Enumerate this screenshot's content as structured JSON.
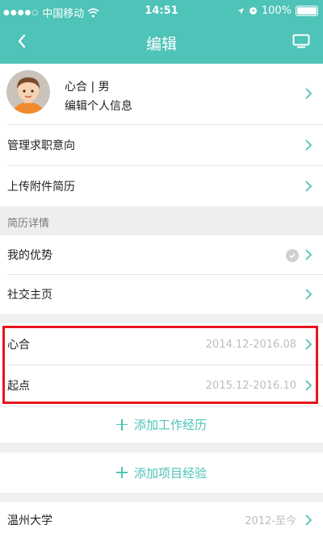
{
  "status_bar": {
    "dots": "●●●●○",
    "carrier": "中国移动",
    "time": "14:51",
    "battery": "100%"
  },
  "nav": {
    "title": "编辑"
  },
  "profile": {
    "name": "心合 | 男",
    "edit_label": "编辑个人信息"
  },
  "menu": {
    "job_intent": "管理求职意向",
    "upload_resume": "上传附件简历"
  },
  "resume_section": {
    "title": "简历详情",
    "my_strengths": "我的优势",
    "social_home": "社交主页"
  },
  "work": [
    {
      "company": "心合",
      "period": "2014.12-2016.08"
    },
    {
      "company": "起点",
      "period": "2015.12-2016.10"
    }
  ],
  "add_work_label": "添加工作经历",
  "add_project_label": "添加项目经验",
  "education": {
    "school": "温州大学",
    "period": "2012-至今"
  },
  "colors": {
    "accent": "#4ec3b7",
    "highlight": "#e8141b"
  },
  "icons": [
    "back-icon",
    "monitor-icon",
    "chevron-right-icon",
    "checkmark-icon",
    "plus-icon",
    "wifi-icon",
    "location-icon",
    "alarm-icon",
    "battery-icon"
  ]
}
